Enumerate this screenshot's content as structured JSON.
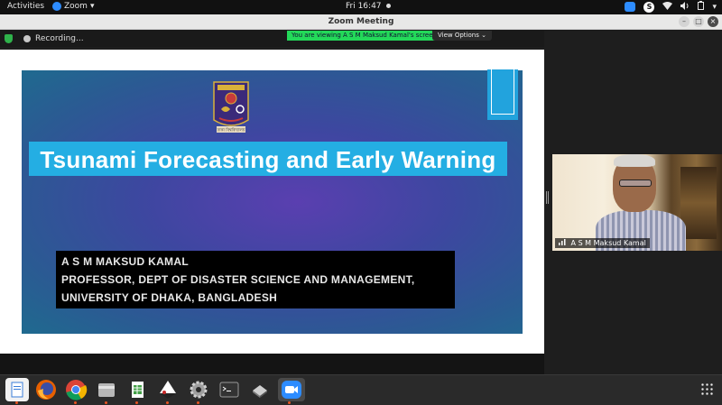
{
  "topbar": {
    "activities": "Activities",
    "app_name": "Zoom",
    "app_menu_icon": "chevron-down-icon",
    "clock": "Fri 16:47",
    "tray_icons": [
      "zoom-tray-icon",
      "skype-tray-icon",
      "wifi-icon",
      "volume-icon",
      "battery-icon",
      "power-menu-icon"
    ]
  },
  "window": {
    "title": "Zoom Meeting"
  },
  "meeting": {
    "recording_text": "Recording...",
    "viewing_banner": "You are viewing A S M Maksud Kamal's screen",
    "view_options": "View Options",
    "colors": {
      "banner_green": "#23d959",
      "shield_green": "#2fb34b"
    }
  },
  "slide": {
    "logo_caption": "ঢাকা বিশ্ববিদ্যালয়",
    "title": "Tsunami Forecasting and Early Warning",
    "presenter_lines": [
      "A S M MAKSUD KAMAL",
      "PROFESSOR, DEPT OF DISASTER SCIENCE AND MANAGEMENT,",
      "UNIVERSITY OF DHAKA, BANGLADESH"
    ],
    "colors": {
      "title_strip": "#24aee3",
      "accent_tab": "#22a3dd"
    }
  },
  "participant": {
    "name": "A S M Maksud Kamal"
  },
  "dock": {
    "apps": [
      "text-editor-icon",
      "firefox-icon",
      "chrome-icon",
      "files-icon",
      "spreadsheet-icon",
      "inkscape-icon",
      "settings-gear-icon",
      "terminal-icon",
      "drive-icon",
      "zoom-icon"
    ]
  }
}
